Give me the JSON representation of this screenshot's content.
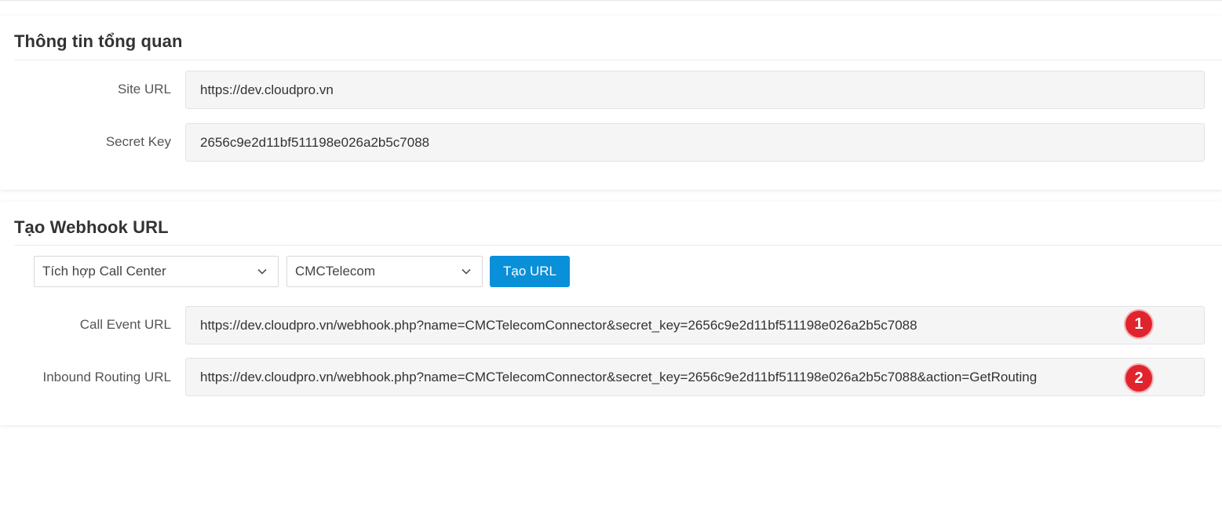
{
  "overview": {
    "title": "Thông tin tổng quan",
    "site_url_label": "Site URL",
    "site_url_value": "https://dev.cloudpro.vn",
    "secret_key_label": "Secret Key",
    "secret_key_value": "2656c9e2d11bf511198e026a2b5c7088"
  },
  "webhook": {
    "title": "Tạo Webhook URL",
    "integration_select": "Tích hợp Call Center",
    "provider_select": "CMCTelecom",
    "create_button": "Tạo URL",
    "call_event_label": "Call Event URL",
    "call_event_value": "https://dev.cloudpro.vn/webhook.php?name=CMCTelecomConnector&secret_key=2656c9e2d11bf511198e026a2b5c7088",
    "inbound_routing_label": "Inbound Routing URL",
    "inbound_routing_value": "https://dev.cloudpro.vn/webhook.php?name=CMCTelecomConnector&secret_key=2656c9e2d11bf511198e026a2b5c7088&action=GetRouting",
    "badge_1": "1",
    "badge_2": "2"
  },
  "colors": {
    "primary": "#0a8fd9",
    "badge": "#e0242d",
    "field_bg": "#f5f5f6"
  }
}
